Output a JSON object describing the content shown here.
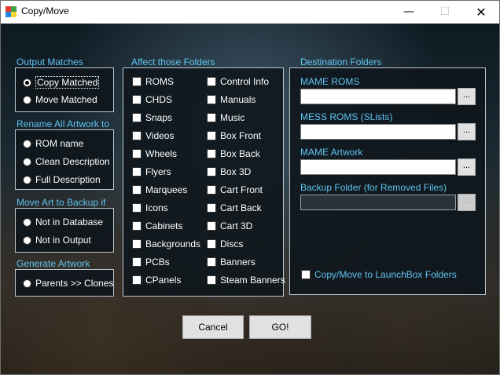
{
  "window": {
    "title": "Copy/Move"
  },
  "output_matches": {
    "label": "Output Matches",
    "options": [
      {
        "label": "Copy Matched",
        "selected": true
      },
      {
        "label": "Move Matched",
        "selected": false
      }
    ]
  },
  "rename_artwork": {
    "label": "Rename All Artwork to",
    "options": [
      {
        "label": "ROM name",
        "selected": false
      },
      {
        "label": "Clean Description",
        "selected": false
      },
      {
        "label": "Full Description",
        "selected": false
      }
    ]
  },
  "move_art": {
    "label": "Move Art to Backup if",
    "options": [
      {
        "label": "Not in Database",
        "selected": false
      },
      {
        "label": "Not in Output",
        "selected": false
      }
    ]
  },
  "generate_artwork": {
    "label": "Generate Artwork",
    "options": [
      {
        "label": "Parents >> Clones",
        "selected": false
      }
    ]
  },
  "affect_folders": {
    "label": "Affect those Folders",
    "col1": [
      "ROMS",
      "CHDS",
      "Snaps",
      "Videos",
      "Wheels",
      "Flyers",
      "Marquees",
      "Icons",
      "Cabinets",
      "Backgrounds",
      "PCBs",
      "CPanels"
    ],
    "col2": [
      "Control Info",
      "Manuals",
      "Music",
      "Box Front",
      "Box Back",
      "Box 3D",
      "Cart Front",
      "Cart Back",
      "Cart 3D",
      "Discs",
      "Banners",
      "Steam Banners"
    ]
  },
  "destination": {
    "label": "Destination Folders",
    "mame_roms_label": "MAME ROMS",
    "mame_roms_value": "",
    "mess_roms_label": "MESS ROMS (SLists)",
    "mess_roms_value": "",
    "mame_artwork_label": "MAME Artwork",
    "mame_artwork_value": "",
    "backup_label": "Backup Folder (for Removed Files)",
    "backup_value": "",
    "browse_label": "...",
    "launchbox_label": "Copy/Move to LaunchBox Folders",
    "launchbox_checked": false
  },
  "buttons": {
    "cancel": "Cancel",
    "go": "GO!"
  },
  "colors": {
    "section_label": "#5fc4f0",
    "option_text": "#ffffff",
    "panel_bg": "#0e161c"
  }
}
